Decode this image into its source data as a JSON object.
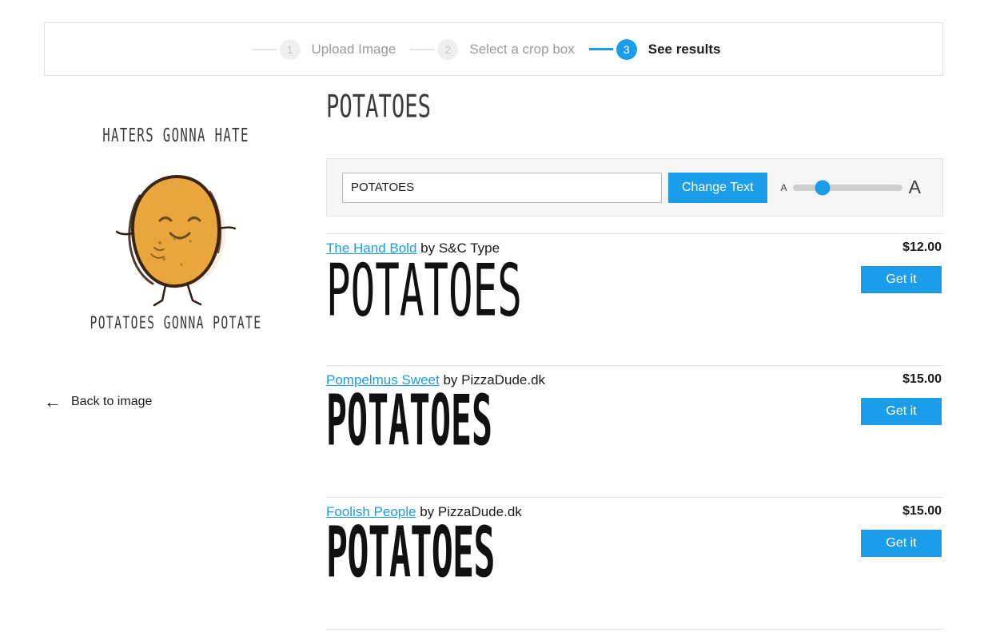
{
  "stepper": {
    "steps": [
      {
        "number": "1",
        "label": "Upload Image",
        "active": false
      },
      {
        "number": "2",
        "label": "Select a crop box",
        "active": false
      },
      {
        "number": "3",
        "label": "See results",
        "active": true
      }
    ]
  },
  "source_image": {
    "top_text": "HATERS GONNA HATE",
    "bottom_text": "POTATOES GONNA POTATE",
    "alt": "potato-illustration"
  },
  "back_link": {
    "arrow": "back-arrow-icon",
    "label": "Back to image"
  },
  "preview": {
    "heading": "POTATOES"
  },
  "controls": {
    "input_value": "POTATOES",
    "input_placeholder": "Enter text",
    "change_button": "Change Text",
    "size_small_label": "A",
    "size_large_label": "A",
    "slider_percent": 27
  },
  "colors": {
    "accent": "#1b9dea",
    "panel_bg": "#f6f6f6",
    "divider": "#e6e6e6",
    "text": "#1b1b1b",
    "muted": "#9b9b9b"
  },
  "results": [
    {
      "font_name": "The Hand Bold",
      "by_text": "by S&C Type",
      "price": "$12.00",
      "button": "Get it",
      "sample": "POTATOES"
    },
    {
      "font_name": "Pompelmus Sweet",
      "by_text": "by PizzaDude.dk",
      "price": "$15.00",
      "button": "Get it",
      "sample": "POTATOES"
    },
    {
      "font_name": "Foolish People",
      "by_text": "by PizzaDude.dk",
      "price": "$15.00",
      "button": "Get it",
      "sample": "POTATOES"
    }
  ]
}
